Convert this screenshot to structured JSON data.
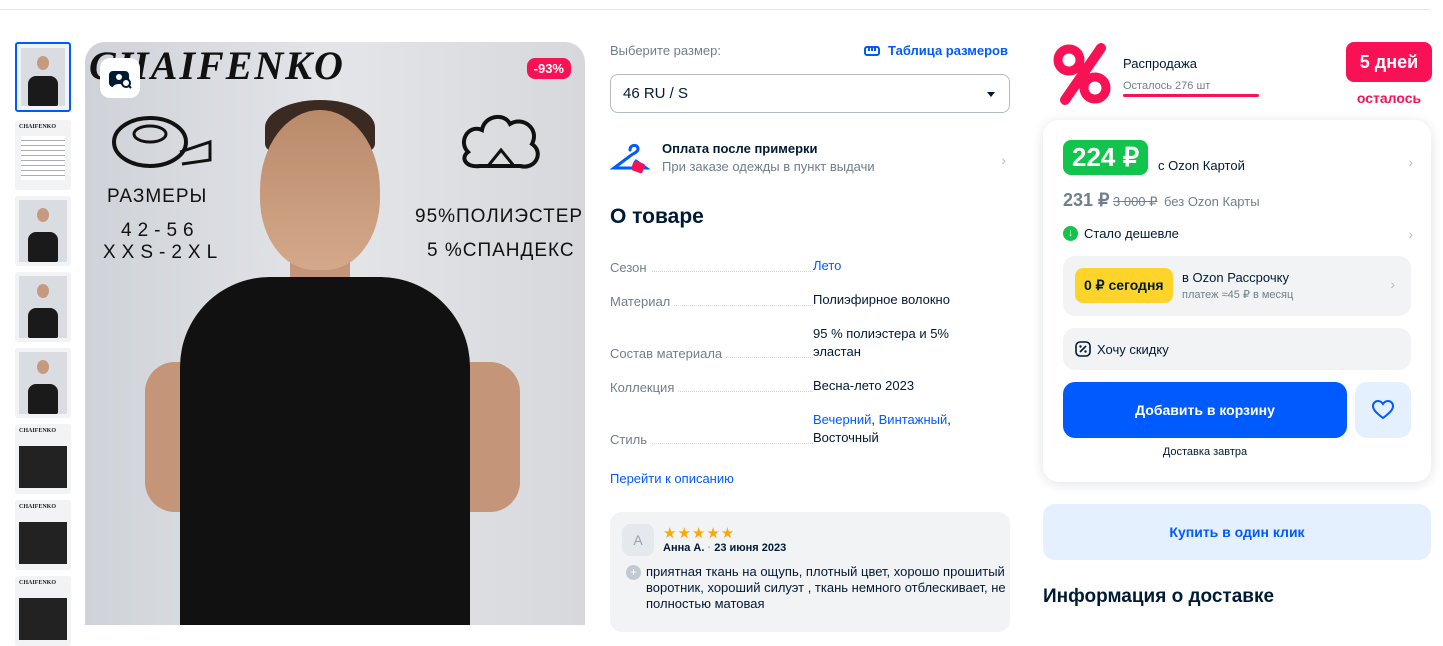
{
  "gallery": {
    "brand": "CHAIFENKO",
    "discount": "-93%",
    "sizes_title": "РАЗМЕРЫ",
    "sizes_range": "42-56",
    "sizes_letters": "XXS-2XL",
    "composition1": "95%ПОЛИЭСТЕР",
    "composition2": "5 %СПАНДЕКС",
    "thumb_brand": "CHAIFENKO"
  },
  "size": {
    "label": "Выберите размер:",
    "table_link": "Таблица размеров",
    "selected": "46 RU / S"
  },
  "pay_after_fitting": {
    "title": "Оплата после примерки",
    "subtitle": "При заказе одежды в пункт выдачи"
  },
  "about": {
    "title": "О товаре",
    "specs": [
      {
        "key": "Сезон",
        "value": "Лето"
      },
      {
        "key": "Материал",
        "value": "Полиэфирное волокно"
      },
      {
        "key": "Состав материала",
        "value": "95 % полиэстера и 5% эластан"
      },
      {
        "key": "Коллекция",
        "value": "Весна-лето 2023"
      },
      {
        "key": "Стиль",
        "value1": "Вечерний",
        "value2": "Винтажный",
        "value3": "Восточный"
      }
    ],
    "goto_description": "Перейти к описанию"
  },
  "review": {
    "avatar": "А",
    "stars": "★★★★★",
    "author": "Анна А.",
    "date": "23 июня 2023",
    "text": "приятная ткань на ощупь, плотный цвет, хорошо прошитый воротник, хороший силуэт , ткань немного отблескивает, не полностью матовая"
  },
  "promo": {
    "title": "Распродажа",
    "remaining": "Осталось 276 шт",
    "days": "5 дней",
    "left": "осталось"
  },
  "price": {
    "card_price": "224 ₽",
    "with_card": "с Ozon Картой",
    "regular_price": "231 ₽",
    "old_price": "3 000 ₽",
    "without_card": "без Ozon Карты",
    "cheaper": "Стало дешевле",
    "installment_badge": "0 ₽ сегодня",
    "installment_title": "в Ozon Рассрочку",
    "installment_sub": "платеж ≈45 ₽ в месяц",
    "want_discount": "Хочу скидку",
    "add_to_cart": "Добавить в корзину",
    "delivery": "Доставка завтра",
    "buy_one_click": "Купить в один клик",
    "delivery_info": "Информация о доставке"
  },
  "colors": {
    "accent": "#005bff",
    "sale": "#f91155",
    "green": "#10c44c",
    "yellow": "#ffd42a"
  }
}
